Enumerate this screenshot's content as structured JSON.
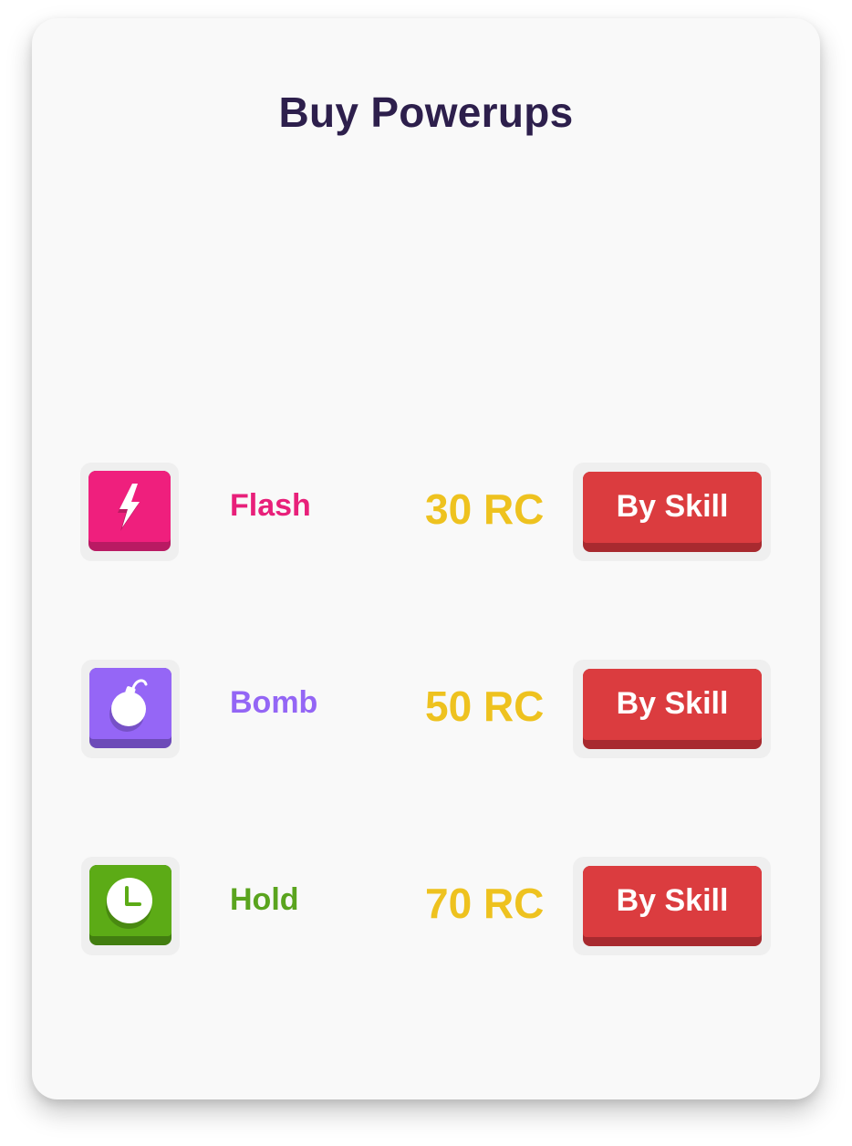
{
  "title": "Buy Powerups",
  "powerups": [
    {
      "name": "Flash",
      "icon": "lightning-icon",
      "price": "30 RC",
      "button_label": "By Skill",
      "name_color": "#e8207a",
      "tile_color": "#ef1f7d",
      "tile_shadow": "#b91a63"
    },
    {
      "name": "Bomb",
      "icon": "bomb-icon",
      "price": "50 RC",
      "button_label": "By Skill",
      "name_color": "#9466f5",
      "tile_color": "#9566f6",
      "tile_shadow": "#6d4bb8"
    },
    {
      "name": "Hold",
      "icon": "clock-icon",
      "price": "70 RC",
      "button_label": "By Skill",
      "name_color": "#5aa41e",
      "tile_color": "#5cab16",
      "tile_shadow": "#427e10"
    }
  ],
  "colors": {
    "price": "#eec21f",
    "button": "#db3c3f",
    "button_shadow": "#a82a2f",
    "title": "#2d1f4c"
  }
}
